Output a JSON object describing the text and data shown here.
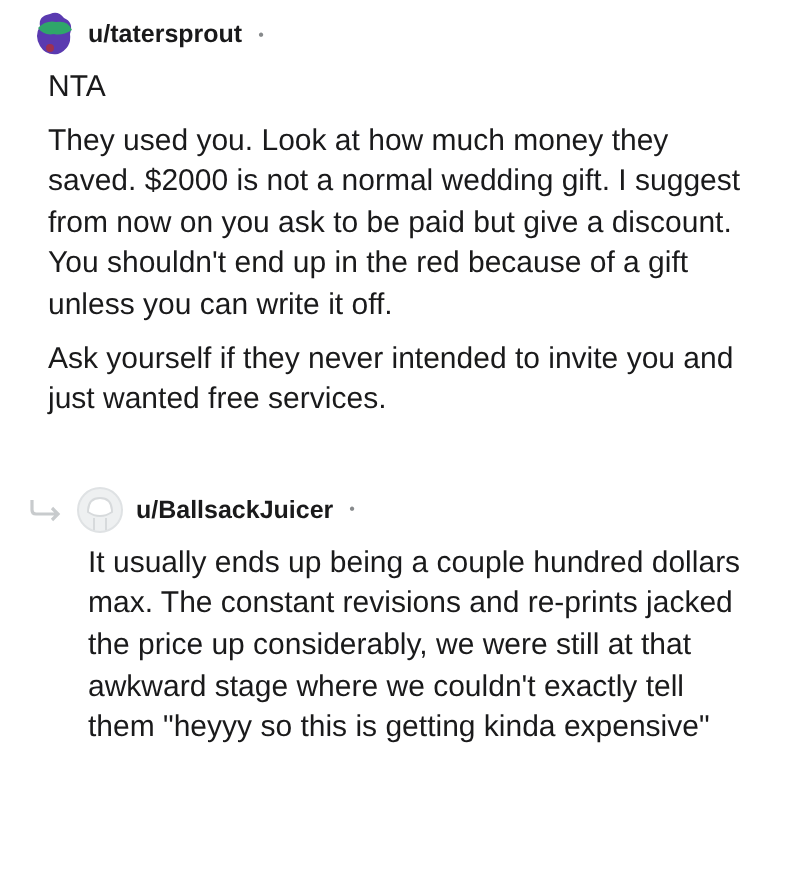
{
  "comments": [
    {
      "author": "u/tatersprout",
      "separator": "•",
      "avatar": {
        "kind": "custom"
      },
      "paragraphs": [
        "NTA",
        "They used you. Look at how much money they saved. $2000 is not a normal wedding gift. I suggest from now on you ask to be paid but give a discount. You shouldn't end up in the red because of a gift unless you can write it off.",
        "Ask yourself if they never intended to invite you and just wanted free services."
      ],
      "is_reply": false
    },
    {
      "author": "u/BallsackJuicer",
      "separator": "•",
      "avatar": {
        "kind": "default"
      },
      "paragraphs": [
        "It usually ends up being a couple hundred dollars max. The constant revisions and re-prints jacked the price up considerably, we were still at that awkward stage where we couldn't exactly tell them \"heyyy so this is getting kinda expensive\""
      ],
      "is_reply": true
    }
  ]
}
